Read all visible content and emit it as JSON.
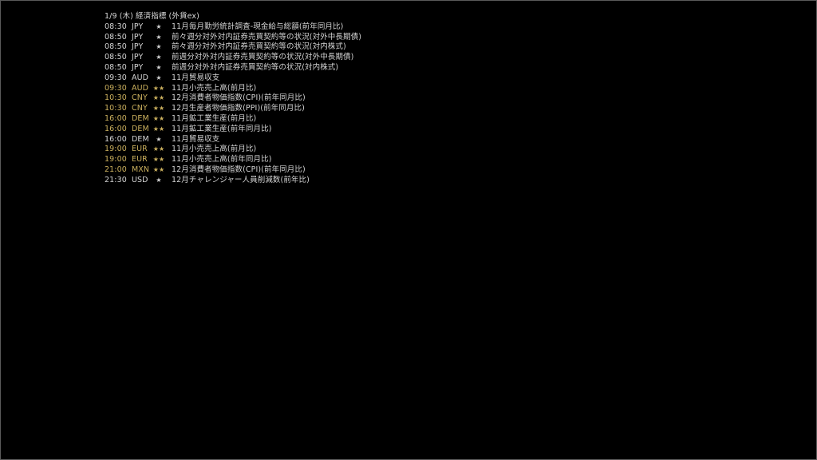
{
  "header": {
    "title": "1/9 (木) 経済指標 (外貨ex)"
  },
  "colors": {
    "background": "#000000",
    "text": "#d4d4d4",
    "highlight": "#ccb15e"
  },
  "events": [
    {
      "time": "08:30",
      "currency": "JPY",
      "stars": "★",
      "importance": 1,
      "name": "11月毎月勤労統計調査-現金給与総額(前年同月比)"
    },
    {
      "time": "08:50",
      "currency": "JPY",
      "stars": "★",
      "importance": 1,
      "name": "前々週分対外対内証券売買契約等の状況(対外中長期債)"
    },
    {
      "time": "08:50",
      "currency": "JPY",
      "stars": "★",
      "importance": 1,
      "name": "前々週分対外対内証券売買契約等の状況(対内株式)"
    },
    {
      "time": "08:50",
      "currency": "JPY",
      "stars": "★",
      "importance": 1,
      "name": "前週分対外対内証券売買契約等の状況(対外中長期債)"
    },
    {
      "time": "08:50",
      "currency": "JPY",
      "stars": "★",
      "importance": 1,
      "name": "前週分対外対内証券売買契約等の状況(対内株式)"
    },
    {
      "time": "09:30",
      "currency": "AUD",
      "stars": "★",
      "importance": 1,
      "name": "11月貿易収支"
    },
    {
      "time": "09:30",
      "currency": "AUD",
      "stars": "★★",
      "importance": 2,
      "name": "11月小売売上高(前月比)"
    },
    {
      "time": "10:30",
      "currency": "CNY",
      "stars": "★★",
      "importance": 2,
      "name": "12月消費者物価指数(CPI)(前年同月比)"
    },
    {
      "time": "10:30",
      "currency": "CNY",
      "stars": "★★",
      "importance": 2,
      "name": "12月生産者物価指数(PPI)(前年同月比)"
    },
    {
      "time": "16:00",
      "currency": "DEM",
      "stars": "★★",
      "importance": 2,
      "name": "11月鉱工業生産(前月比)"
    },
    {
      "time": "16:00",
      "currency": "DEM",
      "stars": "★★",
      "importance": 2,
      "name": "11月鉱工業生産(前年同月比)"
    },
    {
      "time": "16:00",
      "currency": "DEM",
      "stars": "★",
      "importance": 1,
      "name": "11月貿易収支"
    },
    {
      "time": "19:00",
      "currency": "EUR",
      "stars": "★★",
      "importance": 2,
      "name": "11月小売売上高(前月比)"
    },
    {
      "time": "19:00",
      "currency": "EUR",
      "stars": "★★",
      "importance": 2,
      "name": "11月小売売上高(前年同月比)"
    },
    {
      "time": "21:00",
      "currency": "MXN",
      "stars": "★★",
      "importance": 2,
      "name": "12月消費者物価指数(CPI)(前年同月比)"
    },
    {
      "time": "21:30",
      "currency": "USD",
      "stars": "★",
      "importance": 1,
      "name": "12月チャレンジャー人員削減数(前年比)"
    }
  ]
}
